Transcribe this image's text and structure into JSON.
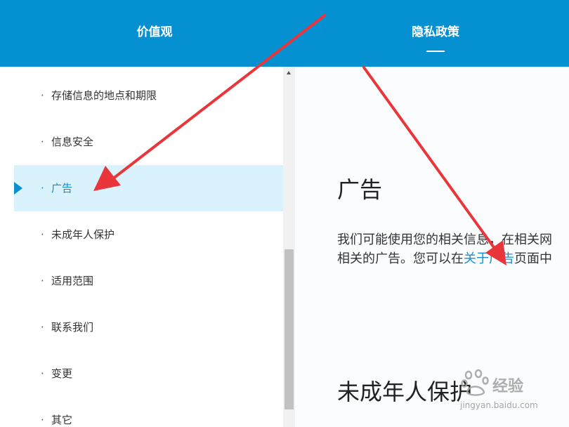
{
  "header": {
    "tabs": [
      {
        "label": "价值观"
      },
      {
        "label": "隐私政策"
      }
    ]
  },
  "sidebar": {
    "items": [
      {
        "label": "存储信息的地点和期限",
        "bullet": "·"
      },
      {
        "label": "信息安全",
        "bullet": "·"
      },
      {
        "label": "广告",
        "bullet": "·",
        "active": true
      },
      {
        "label": "未成年人保护",
        "bullet": "·"
      },
      {
        "label": "适用范围",
        "bullet": "·"
      },
      {
        "label": "联系我们",
        "bullet": "·"
      },
      {
        "label": "变更",
        "bullet": "·"
      },
      {
        "label": "其它",
        "bullet": "·"
      }
    ]
  },
  "content": {
    "section1_title": "广告",
    "para_line1": "我们可能使用您的相关信息，在相关网",
    "para_line2_pre": "相关的广告。您可以在",
    "para_link": "关于广告",
    "para_line2_post": "页面中",
    "section2_title": "未成年人保护"
  },
  "watermark": {
    "brand": "经验",
    "url": "jingyan.baidu.com"
  },
  "colors": {
    "header_bg": "#0590d2",
    "active_bg": "#daf2fb",
    "accent": "#0a8fcf",
    "link": "#1490d6",
    "arrow": "#e8363b"
  }
}
